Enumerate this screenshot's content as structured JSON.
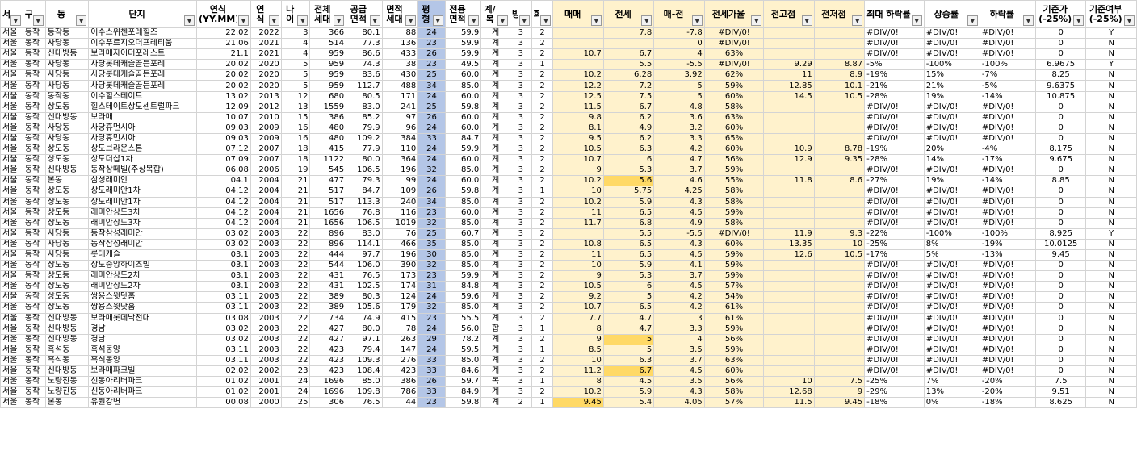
{
  "columns": [
    "서울",
    "구",
    "동",
    "단지",
    "연식(YY.MM)",
    "연식",
    "나이",
    "전체세대",
    "공급면적",
    "면적세대",
    "평형",
    "전용면적",
    "계/복",
    "방",
    "화",
    "매매",
    "전세",
    "매-전",
    "전세가율",
    "전고점",
    "전저점",
    "최대하락률",
    "상승률",
    "하락률",
    "기준가(-25%)",
    "기준여부(-25%)"
  ],
  "header_labels": [
    "서",
    "구",
    "동",
    "단지",
    "연식(YY.MM)",
    "연식",
    "나이",
    "전체 세대",
    "공급 면적",
    "면적 세대",
    "평형",
    "전용 면적",
    "계/복",
    "방",
    "화",
    "매매",
    "전세",
    "매-전",
    "전세가율",
    "전고점",
    "전저점",
    "최대 하락률",
    "상승률",
    "하락률",
    "기준가 (-25%)",
    "기준여부 (-25%)"
  ],
  "rows": [
    [
      "서울",
      "동작",
      "동작동",
      "이수스위첸포레힐즈",
      "22.02",
      "2022",
      "3",
      "366",
      "80.1",
      "88",
      "24",
      "59.9",
      "계",
      "3",
      "2",
      "",
      "7.8",
      "-7.8",
      "#DIV/0!",
      "",
      "",
      "#DIV/0!",
      "#DIV/0!",
      "#DIV/0!",
      "0",
      "Y"
    ],
    [
      "서울",
      "동작",
      "사당동",
      "이수푸르지오더프레티움",
      "21.06",
      "2021",
      "4",
      "514",
      "77.3",
      "136",
      "23",
      "59.9",
      "계",
      "3",
      "2",
      "",
      "",
      "0",
      "#DIV/0!",
      "",
      "",
      "#DIV/0!",
      "#DIV/0!",
      "#DIV/0!",
      "0",
      "N"
    ],
    [
      "서울",
      "동작",
      "신대방동",
      "보라매자이더포레스트",
      "21.1",
      "2021",
      "4",
      "959",
      "86.6",
      "433",
      "26",
      "59.9",
      "계",
      "3",
      "2",
      "10.7",
      "6.7",
      "4",
      "63%",
      "",
      "",
      "#DIV/0!",
      "#DIV/0!",
      "#DIV/0!",
      "0",
      "N"
    ],
    [
      "서울",
      "동작",
      "사당동",
      "사당롯데캐슬골든포레",
      "20.02",
      "2020",
      "5",
      "959",
      "74.3",
      "38",
      "23",
      "49.5",
      "계",
      "3",
      "1",
      "",
      "5.5",
      "-5.5",
      "#DIV/0!",
      "9.29",
      "8.87",
      "-5%",
      "-100%",
      "-100%",
      "6.9675",
      "Y"
    ],
    [
      "서울",
      "동작",
      "사당동",
      "사당롯데캐슬골든포레",
      "20.02",
      "2020",
      "5",
      "959",
      "83.6",
      "430",
      "25",
      "60.0",
      "계",
      "3",
      "2",
      "10.2",
      "6.28",
      "3.92",
      "62%",
      "11",
      "8.9",
      "-19%",
      "15%",
      "-7%",
      "8.25",
      "N"
    ],
    [
      "서울",
      "동작",
      "사당동",
      "사당롯데캐슬골든포레",
      "20.02",
      "2020",
      "5",
      "959",
      "112.7",
      "488",
      "34",
      "85.0",
      "계",
      "3",
      "2",
      "12.2",
      "7.2",
      "5",
      "59%",
      "12.85",
      "10.1",
      "-21%",
      "21%",
      "-5%",
      "9.6375",
      "N"
    ],
    [
      "서울",
      "동작",
      "동작동",
      "이수힐스테이트",
      "13.02",
      "2013",
      "12",
      "680",
      "80.5",
      "171",
      "24",
      "60.0",
      "계",
      "3",
      "2",
      "12.5",
      "7.5",
      "5",
      "60%",
      "14.5",
      "10.5",
      "-28%",
      "19%",
      "-14%",
      "10.875",
      "N"
    ],
    [
      "서울",
      "동작",
      "상도동",
      "힐스테이트상도센트럴파크",
      "12.09",
      "2012",
      "13",
      "1559",
      "83.0",
      "241",
      "25",
      "59.8",
      "계",
      "3",
      "2",
      "11.5",
      "6.7",
      "4.8",
      "58%",
      "",
      "",
      "#DIV/0!",
      "#DIV/0!",
      "#DIV/0!",
      "0",
      "N"
    ],
    [
      "서울",
      "동작",
      "신대방동",
      "보라매",
      "10.07",
      "2010",
      "15",
      "386",
      "85.2",
      "97",
      "26",
      "60.0",
      "계",
      "3",
      "2",
      "9.8",
      "6.2",
      "3.6",
      "63%",
      "",
      "",
      "#DIV/0!",
      "#DIV/0!",
      "#DIV/0!",
      "0",
      "N"
    ],
    [
      "서울",
      "동작",
      "사당동",
      "사당휴먼시아",
      "09.03",
      "2009",
      "16",
      "480",
      "79.9",
      "96",
      "24",
      "60.0",
      "계",
      "3",
      "2",
      "8.1",
      "4.9",
      "3.2",
      "60%",
      "",
      "",
      "#DIV/0!",
      "#DIV/0!",
      "#DIV/0!",
      "0",
      "N"
    ],
    [
      "서울",
      "동작",
      "사당동",
      "사당휴먼시아",
      "09.03",
      "2009",
      "16",
      "480",
      "109.2",
      "384",
      "33",
      "84.7",
      "계",
      "3",
      "2",
      "9.5",
      "6.2",
      "3.3",
      "65%",
      "",
      "",
      "#DIV/0!",
      "#DIV/0!",
      "#DIV/0!",
      "0",
      "N"
    ],
    [
      "서울",
      "동작",
      "상도동",
      "상도브라운스톤",
      "07.12",
      "2007",
      "18",
      "415",
      "77.9",
      "110",
      "24",
      "59.9",
      "계",
      "3",
      "2",
      "10.5",
      "6.3",
      "4.2",
      "60%",
      "10.9",
      "8.78",
      "-19%",
      "20%",
      "-4%",
      "8.175",
      "N"
    ],
    [
      "서울",
      "동작",
      "상도동",
      "상도더샵1차",
      "07.09",
      "2007",
      "18",
      "1122",
      "80.0",
      "364",
      "24",
      "60.0",
      "계",
      "3",
      "2",
      "10.7",
      "6",
      "4.7",
      "56%",
      "12.9",
      "9.35",
      "-28%",
      "14%",
      "-17%",
      "9.675",
      "N"
    ],
    [
      "서울",
      "동작",
      "신대방동",
      "동작상떼빌(주상복합)",
      "06.08",
      "2006",
      "19",
      "545",
      "106.5",
      "196",
      "32",
      "85.0",
      "계",
      "3",
      "2",
      "9",
      "5.3",
      "3.7",
      "59%",
      "",
      "",
      "#DIV/0!",
      "#DIV/0!",
      "#DIV/0!",
      "0",
      "N"
    ],
    [
      "서울",
      "동작",
      "본동",
      "삼성래미안",
      "04.1",
      "2004",
      "21",
      "477",
      "79.3",
      "99",
      "24",
      "60.0",
      "계",
      "3",
      "2",
      "10.2",
      "5.6",
      "4.6",
      "55%",
      "11.8",
      "8.6",
      "-27%",
      "19%",
      "-14%",
      "8.85",
      "N"
    ],
    [
      "서울",
      "동작",
      "상도동",
      "상도래미안1차",
      "04.12",
      "2004",
      "21",
      "517",
      "84.7",
      "109",
      "26",
      "59.8",
      "계",
      "3",
      "1",
      "10",
      "5.75",
      "4.25",
      "58%",
      "",
      "",
      "#DIV/0!",
      "#DIV/0!",
      "#DIV/0!",
      "0",
      "N"
    ],
    [
      "서울",
      "동작",
      "상도동",
      "상도래미안1차",
      "04.12",
      "2004",
      "21",
      "517",
      "113.3",
      "240",
      "34",
      "85.0",
      "계",
      "3",
      "2",
      "10.2",
      "5.9",
      "4.3",
      "58%",
      "",
      "",
      "#DIV/0!",
      "#DIV/0!",
      "#DIV/0!",
      "0",
      "N"
    ],
    [
      "서울",
      "동작",
      "상도동",
      "래미안상도3차",
      "04.12",
      "2004",
      "21",
      "1656",
      "76.8",
      "116",
      "23",
      "60.0",
      "계",
      "3",
      "2",
      "11",
      "6.5",
      "4.5",
      "59%",
      "",
      "",
      "#DIV/0!",
      "#DIV/0!",
      "#DIV/0!",
      "0",
      "N"
    ],
    [
      "서울",
      "동작",
      "상도동",
      "래미안상도3차",
      "04.12",
      "2004",
      "21",
      "1656",
      "106.5",
      "1019",
      "32",
      "85.0",
      "계",
      "3",
      "2",
      "11.7",
      "6.8",
      "4.9",
      "58%",
      "",
      "",
      "#DIV/0!",
      "#DIV/0!",
      "#DIV/0!",
      "0",
      "N"
    ],
    [
      "서울",
      "동작",
      "사당동",
      "동작삼성래미안",
      "03.02",
      "2003",
      "22",
      "896",
      "83.0",
      "76",
      "25",
      "60.7",
      "계",
      "3",
      "2",
      "",
      "5.5",
      "-5.5",
      "#DIV/0!",
      "11.9",
      "9.3",
      "-22%",
      "-100%",
      "-100%",
      "8.925",
      "Y"
    ],
    [
      "서울",
      "동작",
      "사당동",
      "동작삼성래미안",
      "03.02",
      "2003",
      "22",
      "896",
      "114.1",
      "466",
      "35",
      "85.0",
      "계",
      "3",
      "2",
      "10.8",
      "6.5",
      "4.3",
      "60%",
      "13.35",
      "10",
      "-25%",
      "8%",
      "-19%",
      "10.0125",
      "N"
    ],
    [
      "서울",
      "동작",
      "사당동",
      "롯데캐슬",
      "03.1",
      "2003",
      "22",
      "444",
      "97.7",
      "196",
      "30",
      "85.0",
      "계",
      "3",
      "2",
      "11",
      "6.5",
      "4.5",
      "59%",
      "12.6",
      "10.5",
      "-17%",
      "5%",
      "-13%",
      "9.45",
      "N"
    ],
    [
      "서울",
      "동작",
      "상도동",
      "상도중앙하이츠빌",
      "03.1",
      "2003",
      "22",
      "544",
      "106.0",
      "390",
      "32",
      "85.0",
      "계",
      "3",
      "2",
      "10",
      "5.9",
      "4.1",
      "59%",
      "",
      "",
      "#DIV/0!",
      "#DIV/0!",
      "#DIV/0!",
      "0",
      "N"
    ],
    [
      "서울",
      "동작",
      "상도동",
      "래미안상도2차",
      "03.1",
      "2003",
      "22",
      "431",
      "76.5",
      "173",
      "23",
      "59.9",
      "계",
      "3",
      "2",
      "9",
      "5.3",
      "3.7",
      "59%",
      "",
      "",
      "#DIV/0!",
      "#DIV/0!",
      "#DIV/0!",
      "0",
      "N"
    ],
    [
      "서울",
      "동작",
      "상도동",
      "래미안상도2차",
      "03.1",
      "2003",
      "22",
      "431",
      "102.5",
      "174",
      "31",
      "84.8",
      "계",
      "3",
      "2",
      "10.5",
      "6",
      "4.5",
      "57%",
      "",
      "",
      "#DIV/0!",
      "#DIV/0!",
      "#DIV/0!",
      "0",
      "N"
    ],
    [
      "서울",
      "동작",
      "상도동",
      "쌍용스윗닷홈",
      "03.11",
      "2003",
      "22",
      "389",
      "80.3",
      "124",
      "24",
      "59.6",
      "계",
      "3",
      "2",
      "9.2",
      "5",
      "4.2",
      "54%",
      "",
      "",
      "#DIV/0!",
      "#DIV/0!",
      "#DIV/0!",
      "0",
      "N"
    ],
    [
      "서울",
      "동작",
      "상도동",
      "쌍용스윗닷홈",
      "03.11",
      "2003",
      "22",
      "389",
      "105.6",
      "179",
      "32",
      "85.0",
      "계",
      "3",
      "2",
      "10.7",
      "6.5",
      "4.2",
      "61%",
      "",
      "",
      "#DIV/0!",
      "#DIV/0!",
      "#DIV/0!",
      "0",
      "N"
    ],
    [
      "서울",
      "동작",
      "신대방동",
      "보라매롯데낙천대",
      "03.08",
      "2003",
      "22",
      "734",
      "74.9",
      "415",
      "23",
      "55.5",
      "계",
      "3",
      "2",
      "7.7",
      "4.7",
      "3",
      "61%",
      "",
      "",
      "#DIV/0!",
      "#DIV/0!",
      "#DIV/0!",
      "0",
      "N"
    ],
    [
      "서울",
      "동작",
      "신대방동",
      "경남",
      "03.02",
      "2003",
      "22",
      "427",
      "80.0",
      "78",
      "24",
      "56.0",
      "합",
      "3",
      "1",
      "8",
      "4.7",
      "3.3",
      "59%",
      "",
      "",
      "#DIV/0!",
      "#DIV/0!",
      "#DIV/0!",
      "0",
      "N"
    ],
    [
      "서울",
      "동작",
      "신대방동",
      "경남",
      "03.02",
      "2003",
      "22",
      "427",
      "97.1",
      "263",
      "29",
      "78.2",
      "계",
      "3",
      "2",
      "9",
      "5",
      "4",
      "56%",
      "",
      "",
      "#DIV/0!",
      "#DIV/0!",
      "#DIV/0!",
      "0",
      "N"
    ],
    [
      "서울",
      "동작",
      "흑석동",
      "흑석동양",
      "03.11",
      "2003",
      "22",
      "423",
      "79.4",
      "147",
      "24",
      "59.5",
      "계",
      "3",
      "1",
      "8.5",
      "5",
      "3.5",
      "59%",
      "",
      "",
      "#DIV/0!",
      "#DIV/0!",
      "#DIV/0!",
      "0",
      "N"
    ],
    [
      "서울",
      "동작",
      "흑석동",
      "흑석동양",
      "03.11",
      "2003",
      "22",
      "423",
      "109.3",
      "276",
      "33",
      "85.0",
      "계",
      "3",
      "2",
      "10",
      "6.3",
      "3.7",
      "63%",
      "",
      "",
      "#DIV/0!",
      "#DIV/0!",
      "#DIV/0!",
      "0",
      "N"
    ],
    [
      "서울",
      "동작",
      "신대방동",
      "보라매파크빌",
      "02.02",
      "2002",
      "23",
      "423",
      "108.4",
      "423",
      "33",
      "84.6",
      "계",
      "3",
      "2",
      "11.2",
      "6.7",
      "4.5",
      "60%",
      "",
      "",
      "#DIV/0!",
      "#DIV/0!",
      "#DIV/0!",
      "0",
      "N"
    ],
    [
      "서울",
      "동작",
      "노량진동",
      "신동아리버파크",
      "01.02",
      "2001",
      "24",
      "1696",
      "85.0",
      "386",
      "26",
      "59.7",
      "복",
      "3",
      "1",
      "8",
      "4.5",
      "3.5",
      "56%",
      "10",
      "7.5",
      "-25%",
      "7%",
      "-20%",
      "7.5",
      "N"
    ],
    [
      "서울",
      "동작",
      "노량진동",
      "신동아리버파크",
      "01.02",
      "2001",
      "24",
      "1696",
      "109.8",
      "786",
      "33",
      "84.9",
      "계",
      "3",
      "2",
      "10.2",
      "5.9",
      "4.3",
      "58%",
      "12.68",
      "9",
      "-29%",
      "13%",
      "-20%",
      "9.51",
      "N"
    ],
    [
      "서울",
      "동작",
      "본동",
      "유원강변",
      "00.08",
      "2000",
      "25",
      "306",
      "76.5",
      "44",
      "23",
      "59.8",
      "계",
      "2",
      "1",
      "9.45",
      "5.4",
      "4.05",
      "57%",
      "11.5",
      "9.45",
      "-18%",
      "0%",
      "-18%",
      "8.625",
      "N"
    ]
  ],
  "highlight_cells": [
    {
      "row": 14,
      "col": 16
    },
    {
      "row": 29,
      "col": 16
    },
    {
      "row": 32,
      "col": 16
    },
    {
      "row": 35,
      "col": 15
    }
  ],
  "colors": {
    "highlight_yellow": "#fff2cc",
    "strong_yellow": "#ffd966",
    "column_blue": "#b4c6e7",
    "gridline": "#d4d4d4"
  },
  "icons": {
    "filter": "filter-dropdown-icon"
  }
}
